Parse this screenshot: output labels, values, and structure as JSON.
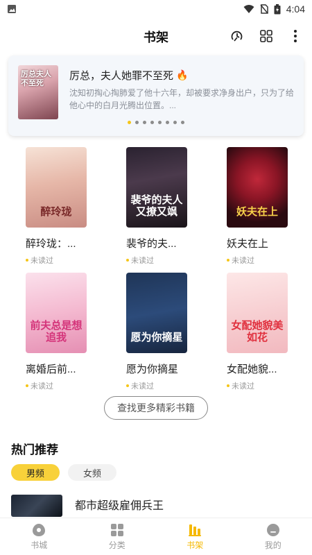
{
  "status_bar": {
    "time": "4:04"
  },
  "app_bar": {
    "title": "书架"
  },
  "featured": {
    "cover_text": "厉总夫人不至死",
    "title": "厉总，夫人她罪不至死",
    "description": "沈知初掏心掏肺爱了他十六年，却被要求净身出户，只为了给他心中的白月光腾出位置。...",
    "dot_count": 8,
    "active_dot": 0
  },
  "books": [
    {
      "title": "醉玲珑：...",
      "status": "未读过",
      "cover_text": "醉玲珑",
      "cover_bg": "linear-gradient(170deg,#f6e2d6 0%,#e6b7a8 45%,#c98c83 100%)",
      "cover_fg": "#7a2a2a"
    },
    {
      "title": "裴爷的夫...",
      "status": "未读过",
      "cover_text": "裴爷的夫人又撩又飒",
      "cover_bg": "linear-gradient(170deg,#2a2230 0%,#4b3a4c 40%,#1a1419 100%)",
      "cover_fg": "#ffffff"
    },
    {
      "title": "妖夫在上",
      "status": "未读过",
      "cover_text": "妖夫在上",
      "cover_bg": "radial-gradient(circle at 50% 40%,#c0283a 0%,#8a1525 35%,#2a0a10 75%)",
      "cover_fg": "#f7d24a"
    },
    {
      "title": "离婚后前...",
      "status": "未读过",
      "cover_text": "前夫总是想追我",
      "cover_bg": "linear-gradient(170deg,#fbe1ec 0%,#f4b9d0 50%,#e58fb3 100%)",
      "cover_fg": "#d4347a"
    },
    {
      "title": "愿为你摘星",
      "status": "未读过",
      "cover_text": "愿为你摘星",
      "cover_bg": "linear-gradient(170deg,#1f3557 0%,#2c4b7a 50%,#17253e 100%)",
      "cover_fg": "#ffffff"
    },
    {
      "title": "女配她貌...",
      "status": "未读过",
      "cover_text": "女配她貌美如花",
      "cover_bg": "linear-gradient(170deg,#fde7e7 0%,#f7cfd2 50%,#f2b9bf 100%)",
      "cover_fg": "#e0303e"
    }
  ],
  "more_button": "查找更多精彩书籍",
  "hot": {
    "title": "热门推荐",
    "tabs": [
      {
        "label": "男频",
        "active": true
      },
      {
        "label": "女频",
        "active": false
      }
    ],
    "first_item_title": "都市超级雇佣兵王"
  },
  "bottom_nav": [
    {
      "label": "书城",
      "icon": "bookstore-icon",
      "active": false
    },
    {
      "label": "分类",
      "icon": "category-icon",
      "active": false
    },
    {
      "label": "书架",
      "icon": "bookshelf-icon",
      "active": true
    },
    {
      "label": "我的",
      "icon": "profile-icon",
      "active": false
    }
  ],
  "colors": {
    "accent": "#f5c518",
    "nav_active": "#f5b800"
  }
}
